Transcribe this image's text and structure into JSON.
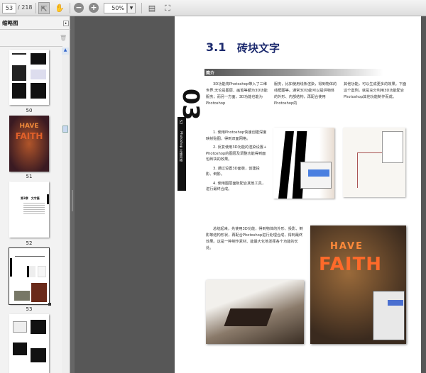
{
  "toolbar": {
    "page_current": "53",
    "page_total": "/ 218",
    "zoom_value": "50%"
  },
  "panel": {
    "title": "缩略图"
  },
  "thumbnails": [
    {
      "label": "50"
    },
    {
      "label": "51"
    },
    {
      "label": "52"
    },
    {
      "label": "53"
    },
    {
      "label": ""
    }
  ],
  "thumb_texts": {
    "faith_top": "HAVE",
    "faith_bottom": "FAITH",
    "p52_title": "第3章　文字篇"
  },
  "page": {
    "section_number": "3.1",
    "section_title": "砖块文字",
    "chapter_number": "03",
    "page_number": "52",
    "side_caption": "Photoshop 三维风格",
    "intro_heading": "简介",
    "intro_cols": [
      "3D功能将Photoshop带入了三维世界,无论是图层、画笔等都为3D功能服务；而另一方面，3D功能也能为Photoshop",
      "服务，比如使用线条渲染，得到物体的线框图等。通常3D功能可以提供物体的外形、内部结构，再配合使用Photoshop的",
      "其他功能，可以生成更多的效果。下面这个案例，就是充分利用3D功能配合Photoshop其他功能制作而成。"
    ],
    "steps": [
      "1. 使用Photoshop快速创建深度映射贴图，得到双面网格。",
      "2. 反复使用3D功能的渲染设置+ Photoshop的图层及调整功能得到面包砖块的效果。",
      "3. 通过设置3D面板，创建投影、倒影。",
      "4. 使用图层面板配合其他工具，进行最终合成。"
    ],
    "summary": "总结起来，先使用3D功能，得到物体的外形、投影、倒影等结构形状，再配合Photoshop进行处理合成，得到最终效果。这是一种制作素材、能最大化地发挥各个功能的长处。",
    "poster_top": "HAVE",
    "poster_bottom": "FAITH"
  },
  "colors": {
    "title": "#1c2a6e",
    "background": "#575757"
  }
}
